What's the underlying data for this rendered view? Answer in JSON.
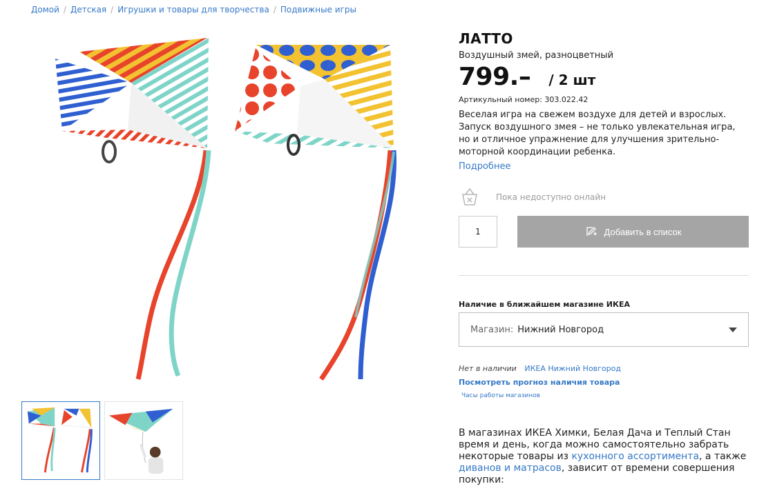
{
  "breadcrumb": [
    {
      "label": "Домой"
    },
    {
      "label": "Детская"
    },
    {
      "label": "Игрушки и товары для творчества"
    },
    {
      "label": "Подвижные игры"
    }
  ],
  "product": {
    "name": "ЛАТТО",
    "subtitle": "Воздушный змей, разноцветный",
    "price": "799.–",
    "unit": "/ 2 шт",
    "article": "Артикульный номер: 303.022.42",
    "description": "Веселая игра на свежем воздухе для детей и взрослых. Запуск воздушного змея – не только увлекательная игра, но и отличное упражнение для улучшения зрительно-моторной координации ребенка.",
    "more_link": "Подробнее"
  },
  "availability": {
    "icon": "basket-unavailable-icon",
    "text": "Пока недоступно онлайн"
  },
  "purchase": {
    "quantity": "1",
    "add_button": "Добавить в список",
    "add_icon": "edit-list-icon"
  },
  "store": {
    "heading": "Наличие в ближайшем магазине ИКЕА",
    "label": "Магазин:",
    "selected": "Нижний Новгород",
    "not_available": "Нет в наличии",
    "store_link": "ИКЕА Нижний Новгород",
    "forecast_link": "Посмотреть прогноз наличия товара",
    "hours_link": "Часы работы магазинов"
  },
  "pickup": {
    "text_1": "В магазинах ИКЕА Химки, Белая Дача и Теплый Стан время и день, когда можно самостоятельно забрать некоторые товары из ",
    "link_1": "кухонного ассортимента",
    "text_2": ", а также ",
    "link_2": "диванов и матрасов",
    "text_3": ", зависит от времени совершения покупки:"
  },
  "colors": {
    "accent": "#3478c6",
    "button_disabled": "#a5a5a5",
    "kite_red": "#e8432b",
    "kite_yellow": "#f2c230",
    "kite_teal": "#7fd4c8",
    "kite_blue": "#2f5fd0"
  }
}
